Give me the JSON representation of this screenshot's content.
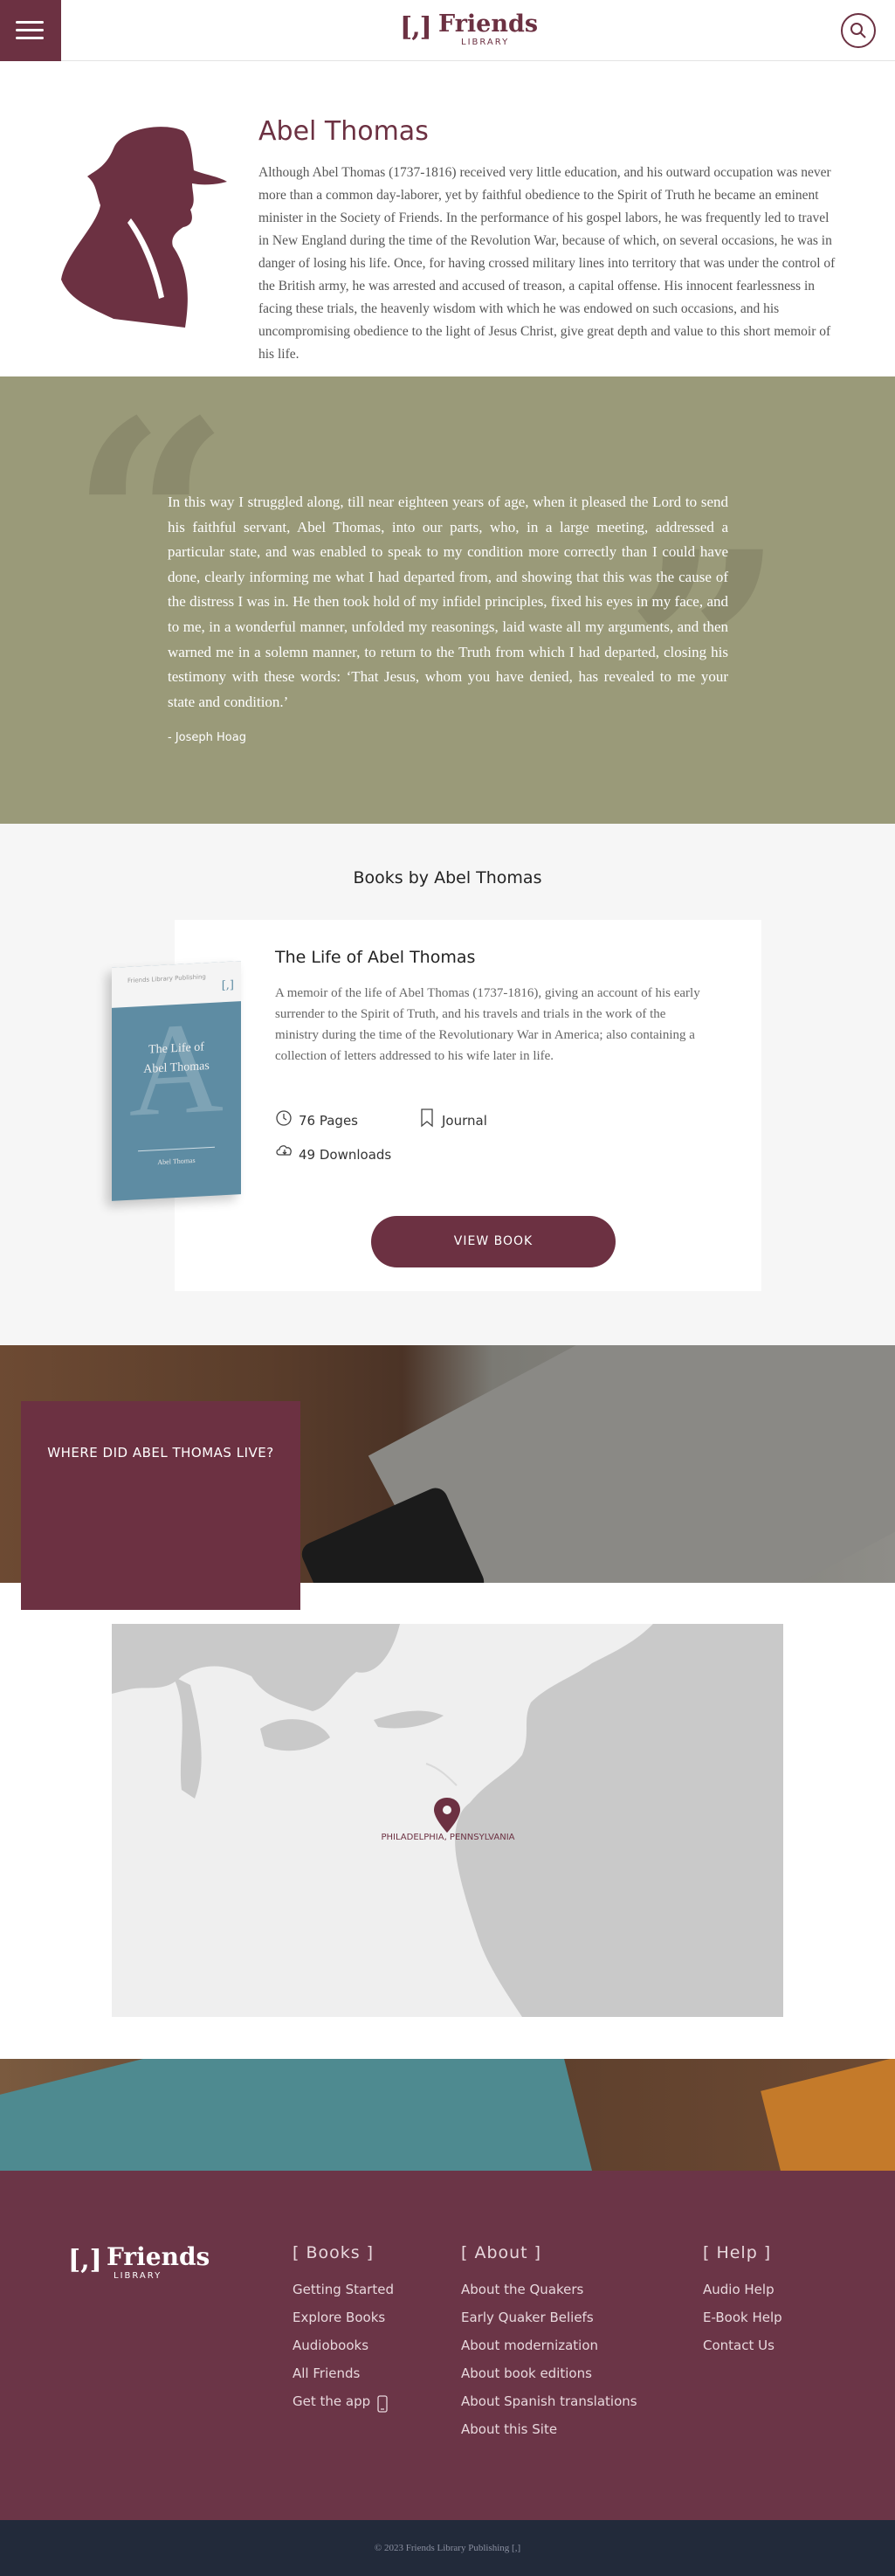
{
  "header": {
    "logo_bracket": "[,]",
    "logo_name": "Friends",
    "logo_sub": "LIBRARY"
  },
  "author": {
    "name": "Abel Thomas",
    "bio": "Although Abel Thomas (1737-1816) received very little education, and his outward occupation was never more than a common day-laborer, yet by faithful obedience to the Spirit of Truth he became an eminent minister in the Society of Friends. In the performance of his gospel labors, he was frequently led to travel in New England during the time of the Revolution War, because of which, on several occasions, he was in danger of losing his life. Once, for having crossed military lines into territory that was under the control of the British army, he was arrested and accused of treason, a capital offense. His innocent fearlessness in facing these trials, the heavenly wisdom with which he was endowed on such occasions, and his uncompromising obedience to the light of Jesus Christ, give great depth and value to this short memoir of his life."
  },
  "quote": {
    "text": "In this way I struggled along, till near eighteen years of age, when it pleased the Lord to send his faithful servant, Abel Thomas, into our parts, who, in a large meeting, addressed a particular state, and was enabled to speak to my condition more correctly than I could have done, clearly informing me what I had departed from, and showing that this was the cause of the distress I was in. He then took hold of my infidel principles, fixed his eyes in my face, and to me, in a wonderful manner, unfolded my reasonings, laid waste all my arguments, and then warned me in a solemn manner, to return to the Truth from which I had departed, closing his testimony with these words: ‘That Jesus, whom you have denied, has revealed to me your state and condition.’",
    "author": "- Joseph Hoag"
  },
  "books": {
    "heading": "Books by Abel Thomas",
    "items": [
      {
        "title": "The Life of Abel Thomas",
        "description": "A memoir of the life of Abel Thomas (1737-1816), giving an account of his early surrender to the Spirit of Truth, and his travels and trials in the work of the ministry during the time of the Revolutionary War in America; also containing a collection of letters addressed to his wife later in life.",
        "pages": "76 Pages",
        "type": "Journal",
        "downloads": "49 Downloads",
        "button": "VIEW BOOK",
        "cover": {
          "series": "Friends Library Publishing",
          "letter": "A",
          "title_line1": "The Life of",
          "title_line2": "Abel Thomas",
          "author": "Abel Thomas",
          "color": "#5e8ca3"
        }
      }
    ]
  },
  "location": {
    "heading": "WHERE DID ABEL THOMAS LIVE?",
    "pin_label": "PHILADELPHIA, PENNSYLVANIA"
  },
  "footer": {
    "logo_bracket": "[,]",
    "logo_name": "Friends",
    "logo_sub": "LIBRARY",
    "columns": [
      {
        "heading": "[ Books ]",
        "links": [
          "Getting Started",
          "Explore Books",
          "Audiobooks",
          "All Friends",
          "Get the app"
        ]
      },
      {
        "heading": "[ About ]",
        "links": [
          "About the Quakers",
          "Early Quaker Beliefs",
          "About modernization",
          "About book editions",
          "About Spanish translations",
          "About this Site"
        ]
      },
      {
        "heading": "[ Help ]",
        "links": [
          "Audio Help",
          "E-Book Help",
          "Contact Us"
        ]
      }
    ],
    "copyright": "© 2023 Friends Library Publishing [,]"
  },
  "colors": {
    "brand": "#6c3142",
    "quote_bg": "#9a9a79",
    "footer_bg": "#6b3547",
    "copyright_bg": "#222a3a"
  },
  "icons": [
    "menu-icon",
    "search-icon",
    "clock-icon",
    "bookmark-icon",
    "cloud-download-icon",
    "phone-icon",
    "map-pin-icon"
  ]
}
